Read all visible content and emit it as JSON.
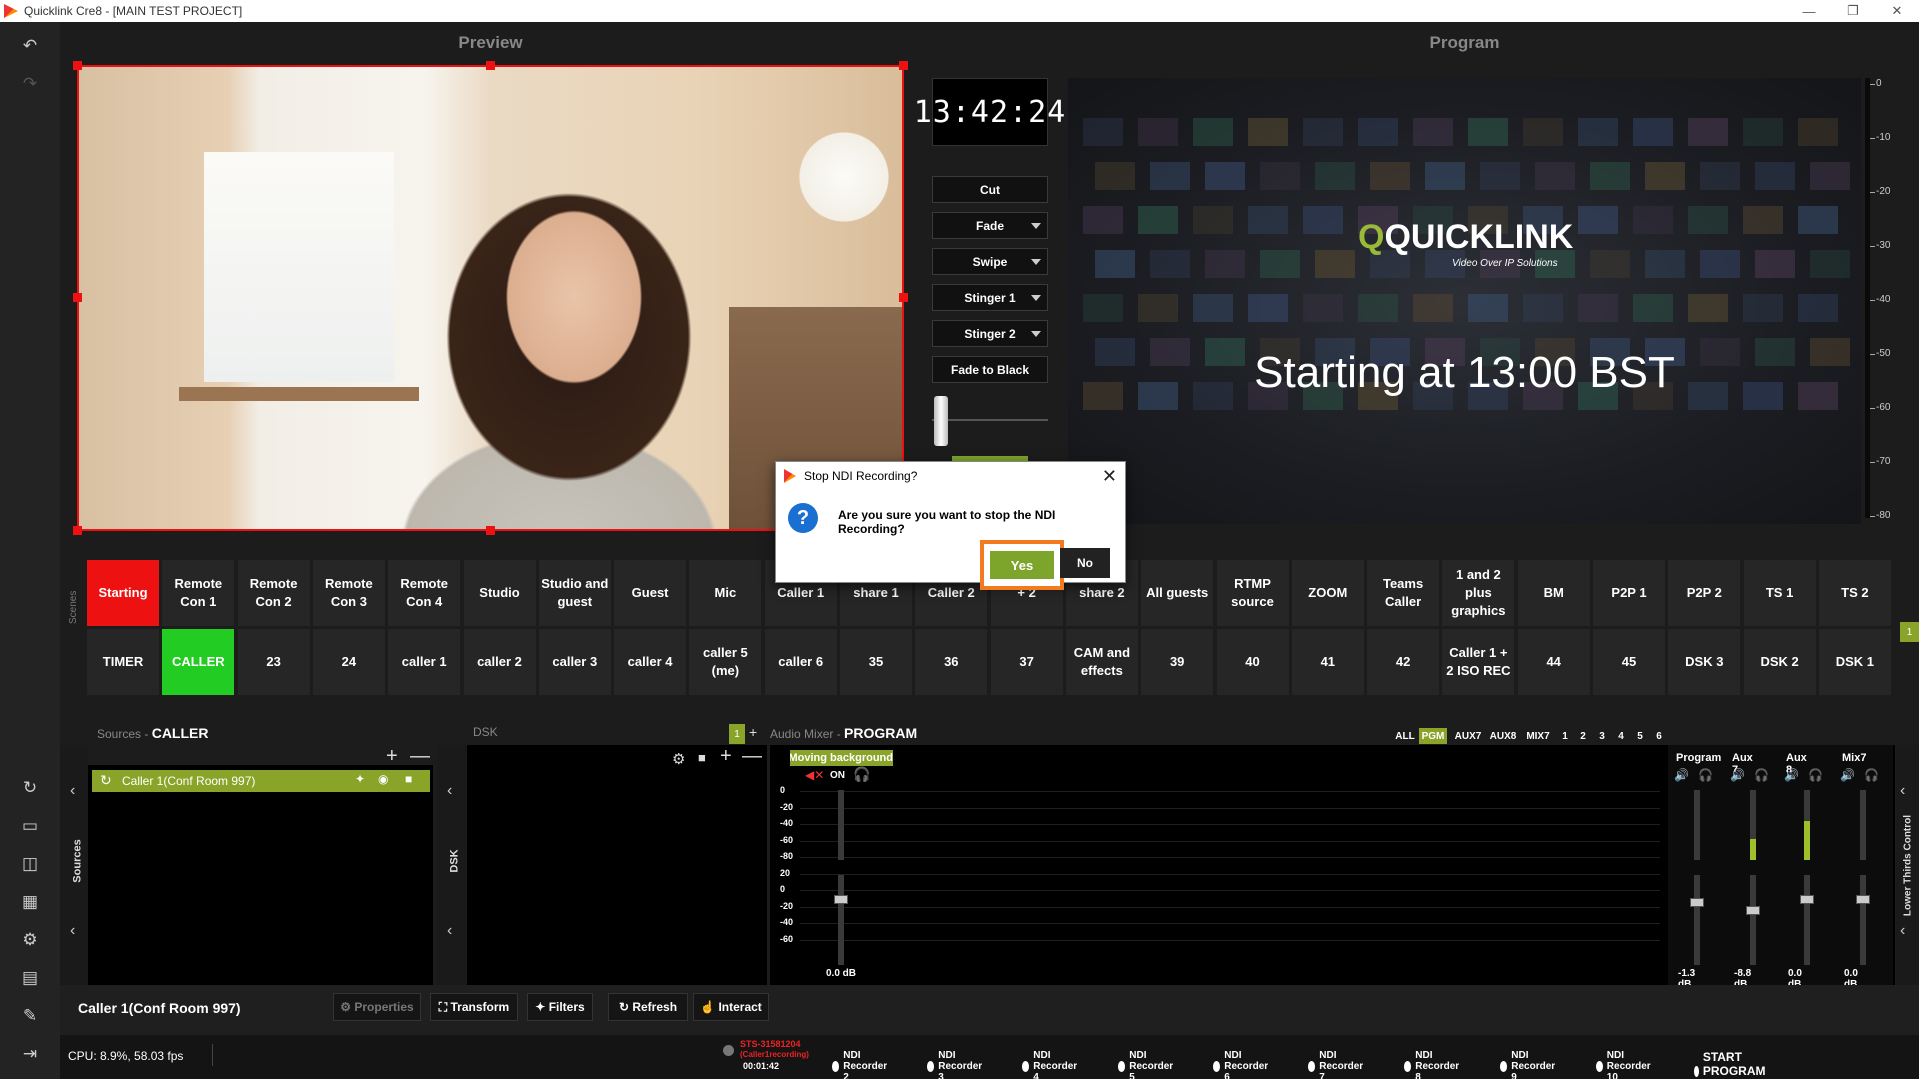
{
  "window": {
    "title": "Quicklink Cre8  - [MAIN TEST PROJECT]"
  },
  "preview": {
    "label": "Preview"
  },
  "program": {
    "label": "Program",
    "logo_text": "QUICKLINK",
    "logo_sub": "Video Over IP Solutions",
    "overlay_text": "Starting at 13:00 BST"
  },
  "clock": {
    "time": "13:42:24"
  },
  "transitions": [
    {
      "label": "Cut",
      "dropdown": false
    },
    {
      "label": "Fade",
      "dropdown": true
    },
    {
      "label": "Swipe",
      "dropdown": true
    },
    {
      "label": "Stinger 1",
      "dropdown": true
    },
    {
      "label": "Stinger 2",
      "dropdown": true
    },
    {
      "label": "Fade to Black",
      "dropdown": false
    }
  ],
  "meter_ticks": [
    "0",
    "-10",
    "-20",
    "-30",
    "-40",
    "-50",
    "-60",
    "-70",
    "-80"
  ],
  "scenes": {
    "label": "Scenes",
    "row1": [
      "Starting",
      "Remote Con 1",
      "Remote Con 2",
      "Remote Con 3",
      "Remote Con 4",
      "Studio",
      "Studio and guest",
      "Guest",
      "Mic",
      "Caller 1",
      "share 1",
      "Caller 2",
      "+ 2",
      "share 2",
      "All guests",
      "RTMP source",
      "ZOOM",
      "Teams Caller",
      "1 and 2 plus graphics",
      "BM",
      "P2P 1",
      "P2P 2",
      "TS 1",
      "TS 2"
    ],
    "row2": [
      "TIMER",
      "CALLER",
      "23",
      "24",
      "caller 1",
      "caller 2",
      "caller 3",
      "caller 4",
      "caller 5 (me)",
      "caller 6",
      "35",
      "36",
      "37",
      "CAM and effects",
      "39",
      "40",
      "41",
      "42",
      "Caller 1 + 2 ISO REC",
      "44",
      "45",
      "DSK 3",
      "DSK 2",
      "DSK 1"
    ],
    "page_badge": "1"
  },
  "dialog": {
    "title": "Stop NDI Recording?",
    "message": "Are you sure you want to stop the NDI Recording?",
    "yes": "Yes",
    "no": "No",
    "close": "✕",
    "icon": "?"
  },
  "sources": {
    "section": "Sources",
    "scene": "CALLER",
    "side_label": "Sources",
    "items": [
      "Caller 1(Conf Room 997)"
    ]
  },
  "dsk": {
    "section": "DSK",
    "side_label": "DSK",
    "page": "1"
  },
  "mixer": {
    "section": "Audio Mixer",
    "target": "PROGRAM",
    "tabs": [
      "ALL",
      "PGM",
      "AUX7",
      "AUX8",
      "MIX7",
      "1",
      "2",
      "3",
      "4",
      "5",
      "6"
    ],
    "active_tab": "PGM",
    "source_name": "Moving background",
    "on_label": "ON",
    "scale": [
      "0",
      "-20",
      "-40",
      "-60",
      "-80",
      "20",
      "0",
      "-20",
      "-40",
      "-60"
    ],
    "source_db": "0.0 dB",
    "channels": [
      {
        "name": "Program",
        "db": "-1.3 dB",
        "level": 0.0
      },
      {
        "name": "Aux 7",
        "db": "-8.8 dB",
        "level": 0.3
      },
      {
        "name": "Aux 8",
        "db": "0.0 dB",
        "level": 0.55
      },
      {
        "name": "Mix7",
        "db": "0.0 dB",
        "level": 0.0
      }
    ],
    "side_label": "Lower Thirds Control"
  },
  "toolbar": {
    "selected": "Caller 1(Conf Room 997)",
    "properties": "Properties",
    "transform": "Transform",
    "filters": "Filters",
    "refresh": "Refresh",
    "interact": "Interact"
  },
  "status": {
    "cpu": "CPU: 8.9%, 58.03 fps",
    "rec_id": "STS-31581204",
    "rec_sub": "(Caller1recording)",
    "rec_time": "00:01:42",
    "recorders": [
      "NDI Recorder 2",
      "NDI Recorder 3",
      "NDI Recorder 4",
      "NDI Recorder 5",
      "NDI Recorder 6",
      "NDI Recorder 7",
      "NDI Recorder 8",
      "NDI Recorder 9",
      "NDI Recorder 10"
    ],
    "program_rec": "START PROGRAM RECORDING"
  },
  "colors": {
    "accent": "#8aa42a",
    "live": "#e11",
    "active_scene": "#22cc22",
    "highlight": "#f47a1f"
  }
}
